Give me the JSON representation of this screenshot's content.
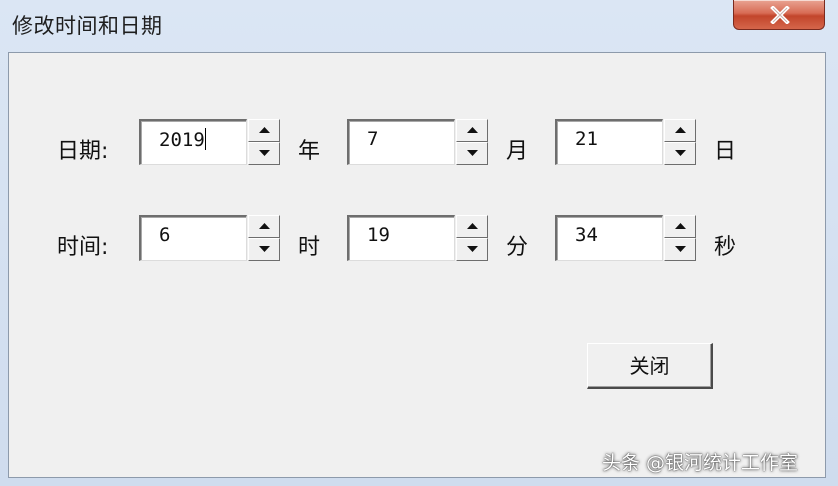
{
  "window": {
    "title": "修改时间和日期"
  },
  "date_row": {
    "label": "日期:",
    "year": {
      "value": "2019",
      "unit": "年"
    },
    "month": {
      "value": "7",
      "unit": "月"
    },
    "day": {
      "value": "21",
      "unit": "日"
    }
  },
  "time_row": {
    "label": "时间:",
    "hour": {
      "value": "6",
      "unit": "时"
    },
    "minute": {
      "value": "19",
      "unit": "分"
    },
    "second": {
      "value": "34",
      "unit": "秒"
    }
  },
  "actions": {
    "close_label": "关闭"
  },
  "watermark": "头条 @银河统计工作室",
  "colors": {
    "titlebar": "#dbe6f4",
    "client_bg": "#f0f0f0",
    "close_button_red": "#c2452b"
  },
  "icons": {
    "window_close": "close-icon",
    "spin_up": "chevron-up-icon",
    "spin_down": "chevron-down-icon"
  }
}
